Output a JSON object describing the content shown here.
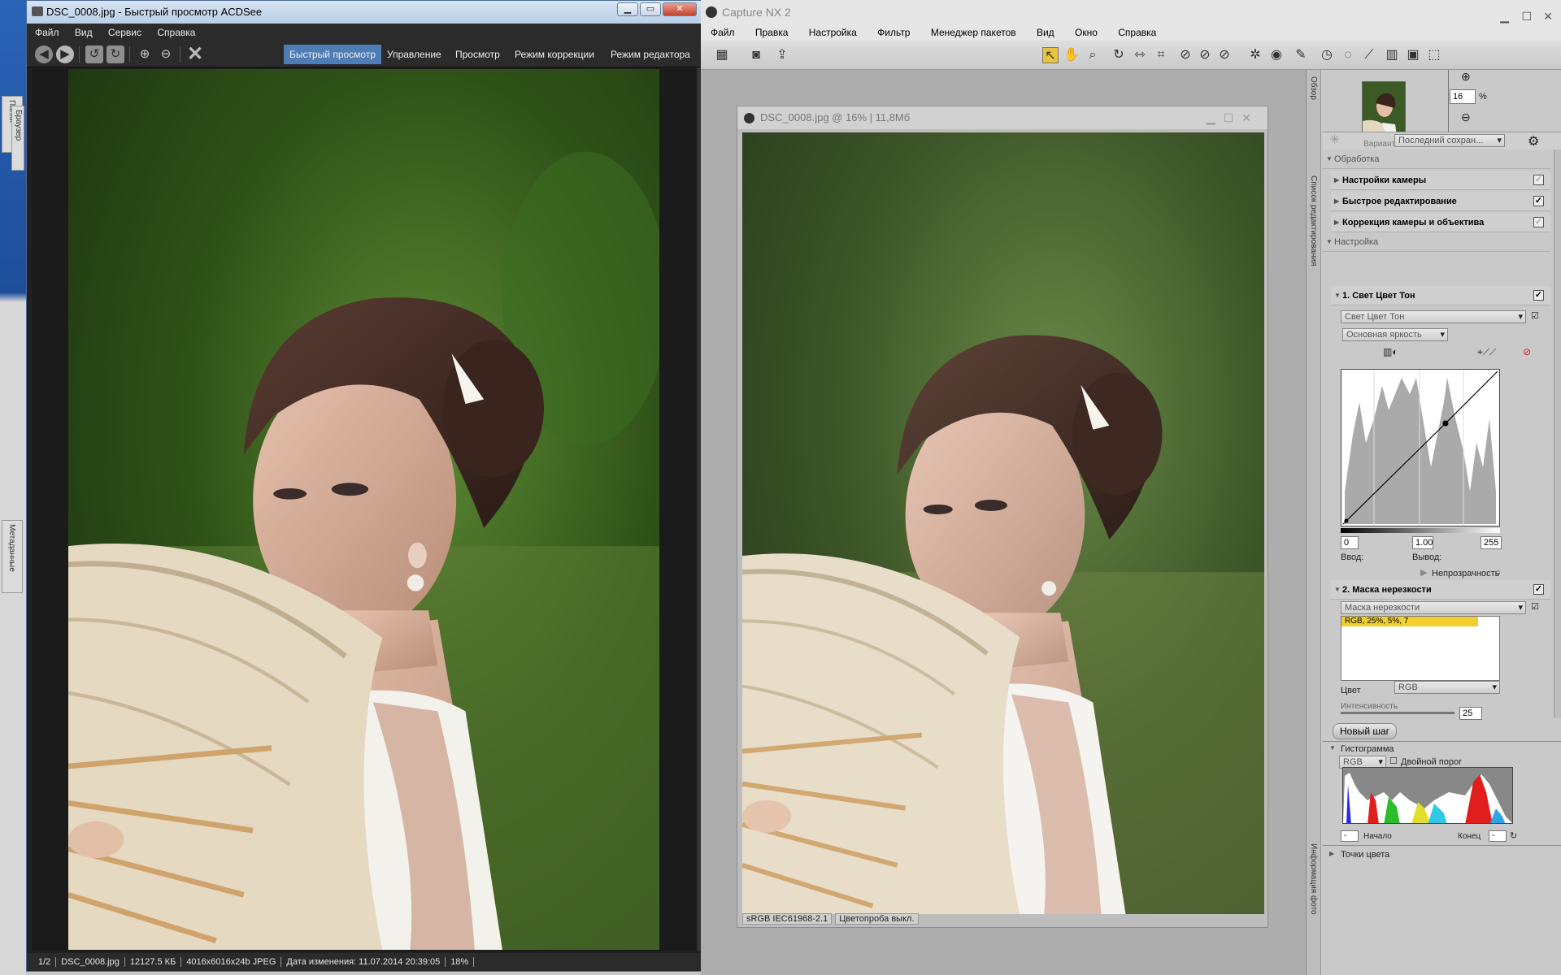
{
  "desktop": {
    "tab_top": "Папки",
    "tab_mid": "Браузер",
    "tab_bottom": "Метаданные"
  },
  "acdsee": {
    "title": "DSC_0008.jpg - Быстрый просмотр ACDSee",
    "menu": [
      "Файл",
      "Вид",
      "Сервис",
      "Справка"
    ],
    "modes": [
      "Быстрый просмотр",
      "Управление",
      "Просмотр",
      "Режим коррекции",
      "Режим редактора"
    ],
    "status": {
      "index": "1/2",
      "filename": "DSC_0008.jpg",
      "size": "12127.5 КБ",
      "dimensions": "4016x6016x24b JPEG",
      "modified": "Дата изменения: 11.07.2014 20:39:05",
      "zoom": "18%"
    }
  },
  "capture": {
    "title": "Capture NX 2",
    "menu": [
      "Файл",
      "Правка",
      "Настройка",
      "Фильтр",
      "Менеджер пакетов",
      "Вид",
      "Окно",
      "Справка"
    ],
    "doc_title": "DSC_0008.jpg @ 16% | 11,8Мб",
    "doc_status": {
      "profile": "sRGB IEC61968-2.1",
      "softproof": "Цветопроба выкл."
    },
    "panel": {
      "tab_overview": "Обзор",
      "tab_editlist": "Список редактирования",
      "tab_photoinfo": "Информация фото",
      "zoom_value": "16",
      "zoom_unit": "%",
      "variant_label": "Вариант",
      "variant_value": "Последний сохран...",
      "sec_processing": "Обработка",
      "camera_settings": "Настройки камеры",
      "quick_edit": "Быстрое редактирование",
      "lens_correction": "Коррекция камеры и объектива",
      "sec_adjust": "Настройка",
      "step1_title": "1. Свет Цвет Тон",
      "step1_combo": "Свет Цвет Тон",
      "channel_combo": "Основная яркость",
      "input_black": "0",
      "gamma": "1.00",
      "input_white": "255",
      "input_label": "Ввод:",
      "output_label": "Вывод:",
      "opacity_label": "Непрозрачность",
      "step2_title": "2. Маска нерезкости",
      "step2_combo": "Маска нерезкости",
      "mask_item": "RGB, 25%, 5%, 7",
      "color_label": "Цвет",
      "color_value": "RGB",
      "intensity_label": "Интенсивность",
      "intensity_value": "25",
      "new_step": "Новый шаг",
      "histogram_label": "Гистограмма",
      "histogram_channel": "RGB",
      "double_threshold": "Двойной порог",
      "start_label": "Начало",
      "start_value": "-",
      "end_label": "Конец",
      "end_value": "-",
      "color_points": "Точки цвета"
    }
  }
}
